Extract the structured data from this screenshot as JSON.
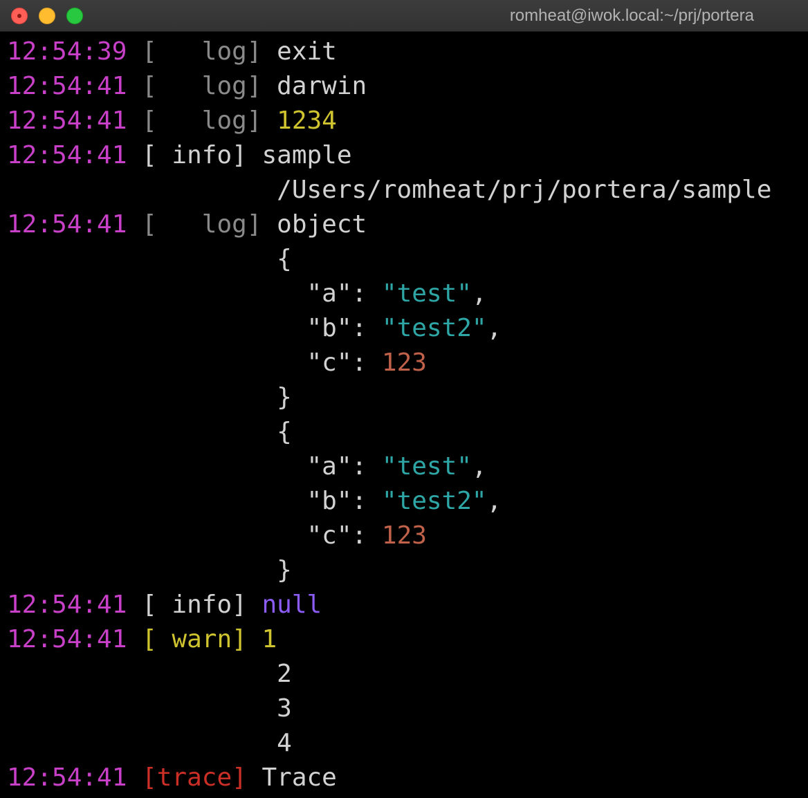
{
  "window": {
    "title": "romheat@iwok.local:~/prj/portera"
  },
  "colors": {
    "timestamp": "#c840c8",
    "level_log": "#8a8a8a",
    "level_info": "#d2d2d2",
    "level_warn": "#cfc32f",
    "level_trace": "#cc2f26",
    "text": "#d2d2d2",
    "number": "#cfc32f",
    "null": "#8b5cf6",
    "json_string": "#2fa6a6",
    "json_number": "#c0614a",
    "background": "#000000"
  },
  "lines": [
    {
      "time": "12:54:39",
      "level": "[   log]",
      "message": "exit"
    },
    {
      "time": "12:54:41",
      "level": "[   log]",
      "message": "darwin"
    },
    {
      "time": "12:54:41",
      "level": "[   log]",
      "message": "1234"
    },
    {
      "time": "12:54:41",
      "level": "[ info]",
      "message": "sample"
    },
    {
      "continuation": "/Users/romheat/prj/portera/sample"
    },
    {
      "time": "12:54:41",
      "level": "[   log]",
      "message": "object"
    },
    {
      "continuation": "{"
    },
    {
      "key": "\"a\"",
      "colon": ":",
      "value": "\"test\"",
      "trail": ","
    },
    {
      "key": "\"b\"",
      "colon": ":",
      "value": "\"test2\"",
      "trail": ","
    },
    {
      "key": "\"c\"",
      "colon": ":",
      "value": "123",
      "trail": ""
    },
    {
      "continuation": "}"
    },
    {
      "continuation": "{"
    },
    {
      "key": "\"a\"",
      "colon": ":",
      "value": "\"test\"",
      "trail": ","
    },
    {
      "key": "\"b\"",
      "colon": ":",
      "value": "\"test2\"",
      "trail": ","
    },
    {
      "key": "\"c\"",
      "colon": ":",
      "value": "123",
      "trail": ""
    },
    {
      "continuation": "}"
    },
    {
      "time": "12:54:41",
      "level": "[ info]",
      "message": "null"
    },
    {
      "time": "12:54:41",
      "level": "[ warn]",
      "message": "1"
    },
    {
      "continuation": "2"
    },
    {
      "continuation": "3"
    },
    {
      "continuation": "4"
    },
    {
      "time": "12:54:41",
      "level": "[trace]",
      "message": "Trace"
    }
  ]
}
